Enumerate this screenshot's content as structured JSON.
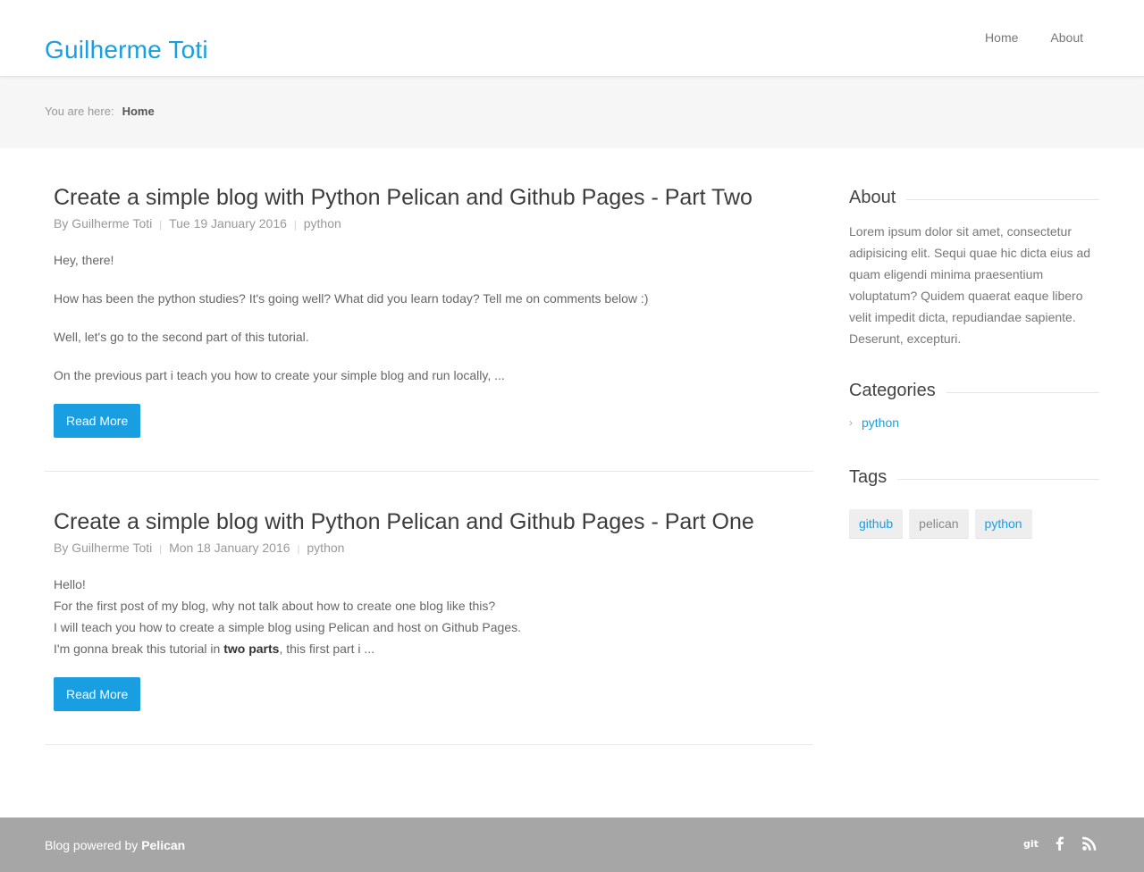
{
  "header": {
    "site_title": "Guilherme Toti",
    "nav": [
      {
        "label": "Home"
      },
      {
        "label": "About"
      }
    ]
  },
  "breadcrumb": {
    "prefix": "You are here:",
    "current": "Home"
  },
  "posts": [
    {
      "title": "Create a simple blog with Python Pelican and Github Pages - Part Two",
      "author": "By Guilherme Toti",
      "date": "Tue 19 January 2016",
      "category": "python",
      "paragraphs": [
        "Hey, there!",
        "How has been the python studies? It's going well? What did you learn today? Tell me on comments below :)",
        "Well, let's go to the second part of this tutorial.",
        "On the previous part i teach you how to create your simple blog and run locally, ..."
      ],
      "read_more": "Read More"
    },
    {
      "title": "Create a simple blog with Python Pelican and Github Pages - Part One",
      "author": "By Guilherme Toti",
      "date": "Mon 18 January 2016",
      "category": "python",
      "lines": [
        "Hello!",
        "For the first post of my blog, why not talk about how to create one blog like this?",
        "I will teach you how to create a simple blog using Pelican and host on Github Pages."
      ],
      "last_line_before": "I'm gonna break this tutorial in ",
      "last_line_bold": "two parts",
      "last_line_after": ", this first part i ...",
      "read_more": "Read More"
    }
  ],
  "sidebar": {
    "about_heading": "About",
    "about_text": "Lorem ipsum dolor sit amet, consectetur adipisicing elit. Sequi quae hic dicta eius ad quam eligendi minima praesentium voluptatum? Quidem quaerat eaque libero velit impedit dicta, repudiandae sapiente. Deserunt, excepturi.",
    "categories_heading": "Categories",
    "categories": [
      {
        "label": "python"
      }
    ],
    "tags_heading": "Tags",
    "tags": [
      {
        "label": "github",
        "color": "#1a9ee2"
      },
      {
        "label": "pelican",
        "color": "#888888"
      },
      {
        "label": "python",
        "color": "#1a9ee2"
      }
    ]
  },
  "footer": {
    "credit_prefix": "Blog powered by ",
    "credit_link": "Pelican",
    "social": [
      {
        "icon": "git-icon",
        "glyph": "git"
      },
      {
        "icon": "facebook-icon",
        "glyph": "f"
      },
      {
        "icon": "rss-icon",
        "glyph": "rss"
      }
    ]
  },
  "colors": {
    "accent": "#1a9ee2",
    "footer_bg": "#a6a6a6",
    "crumb_bg": "#f6f6f6"
  }
}
